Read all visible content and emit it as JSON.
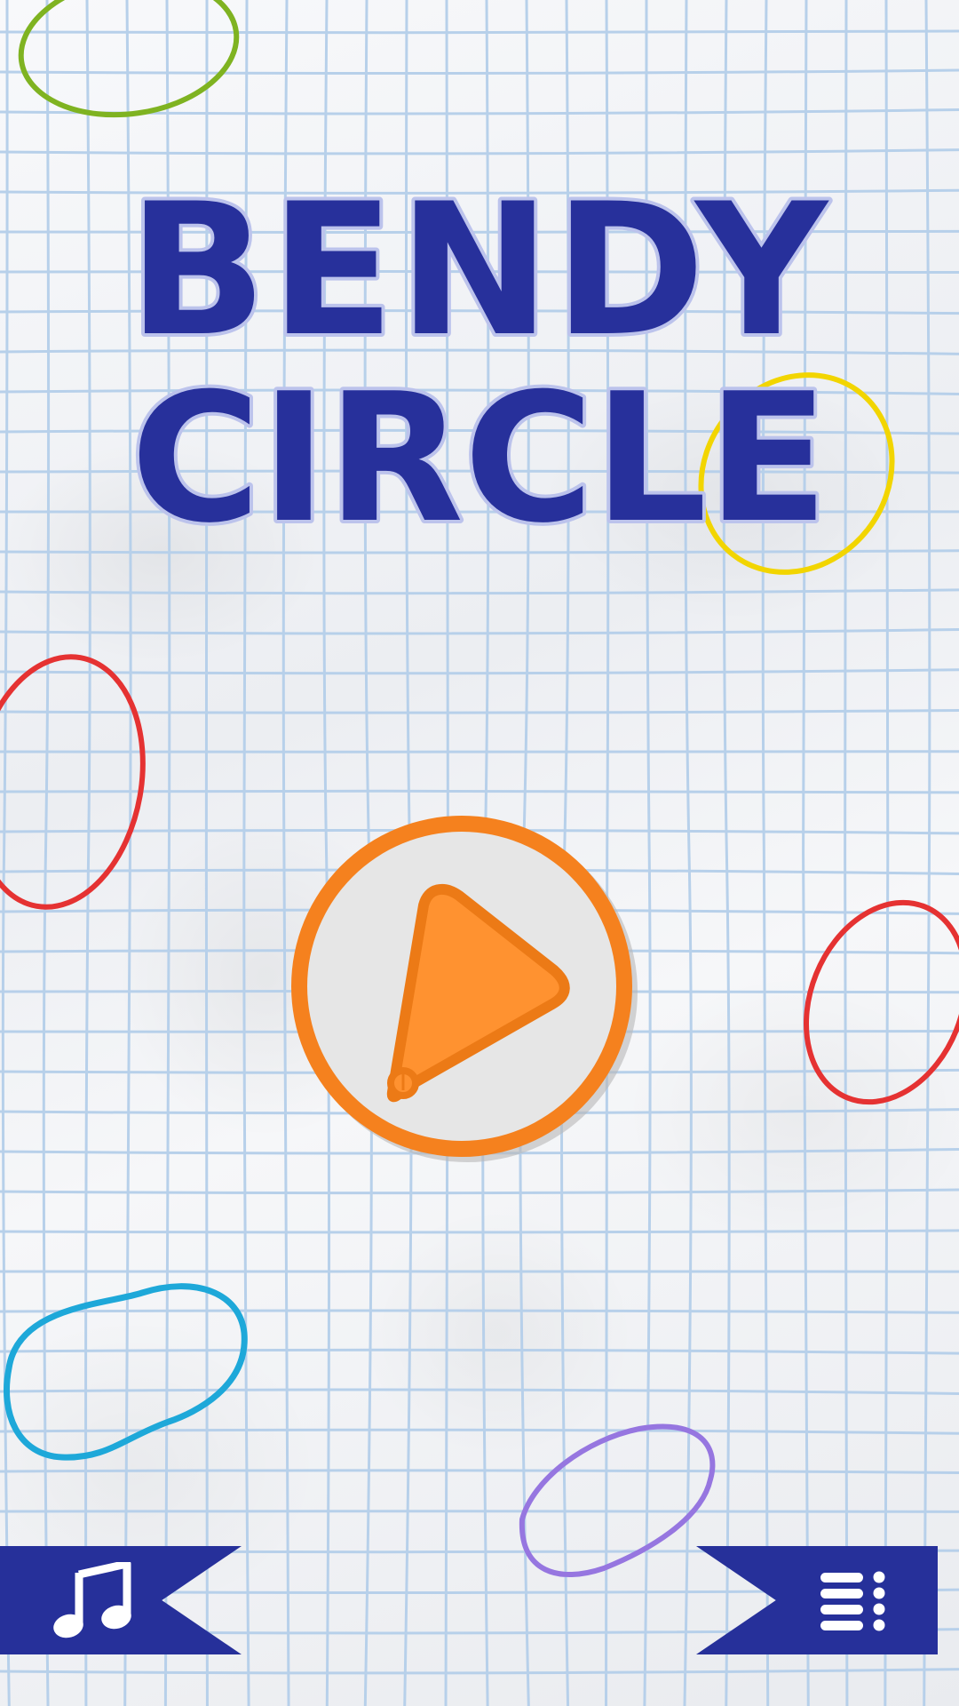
{
  "game": {
    "title_line1": "BENDY",
    "title_line2": "CIRCLE"
  },
  "colors": {
    "title_fill": "#27309b",
    "title_outline": "#bcc3ec",
    "play_ring": "#f5811e",
    "play_face": "#e6e6e6",
    "banner": "#26309a",
    "grid_line": "#b7d0ea",
    "rings": [
      "#7fb321",
      "#f2d500",
      "#e53232",
      "#e53232",
      "#1ea8d9",
      "#9676e0"
    ]
  },
  "controls": {
    "play_icon": "play-icon",
    "music_icon": "music-note-icon",
    "menu_icon": "menu-list-icon"
  }
}
